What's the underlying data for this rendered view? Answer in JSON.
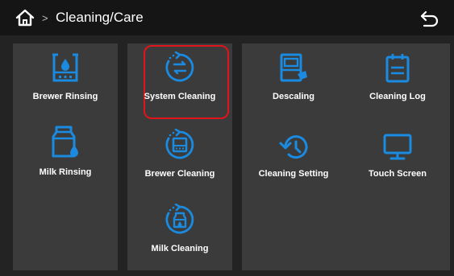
{
  "header": {
    "title": "Cleaning/Care",
    "separator": ">",
    "home_icon": "home-icon",
    "back_icon": "back-arrow-icon"
  },
  "tiles": {
    "brewer_rinsing": {
      "label": "Brewer Rinsing",
      "icon": "brewer-rinsing-icon"
    },
    "milk_rinsing": {
      "label": "Milk Rinsing",
      "icon": "milk-rinsing-icon"
    },
    "system_cleaning": {
      "label": "System Cleaning",
      "icon": "system-cleaning-icon",
      "selected": true
    },
    "brewer_cleaning": {
      "label": "Brewer Cleaning",
      "icon": "brewer-cleaning-icon"
    },
    "milk_cleaning": {
      "label": "Milk Cleaning",
      "icon": "milk-cleaning-icon"
    },
    "descaling": {
      "label": "Descaling",
      "icon": "descaling-icon"
    },
    "cleaning_log": {
      "label": "Cleaning Log",
      "icon": "cleaning-log-icon"
    },
    "cleaning_setting": {
      "label": "Cleaning Setting",
      "icon": "cleaning-setting-icon"
    },
    "touch_screen": {
      "label": "Touch Screen",
      "icon": "touch-screen-icon"
    }
  },
  "colors": {
    "accent_blue": "#1a8be0",
    "selection_red": "#e0141a",
    "panel_bg": "#3b3b3b",
    "header_bg": "#151515"
  }
}
